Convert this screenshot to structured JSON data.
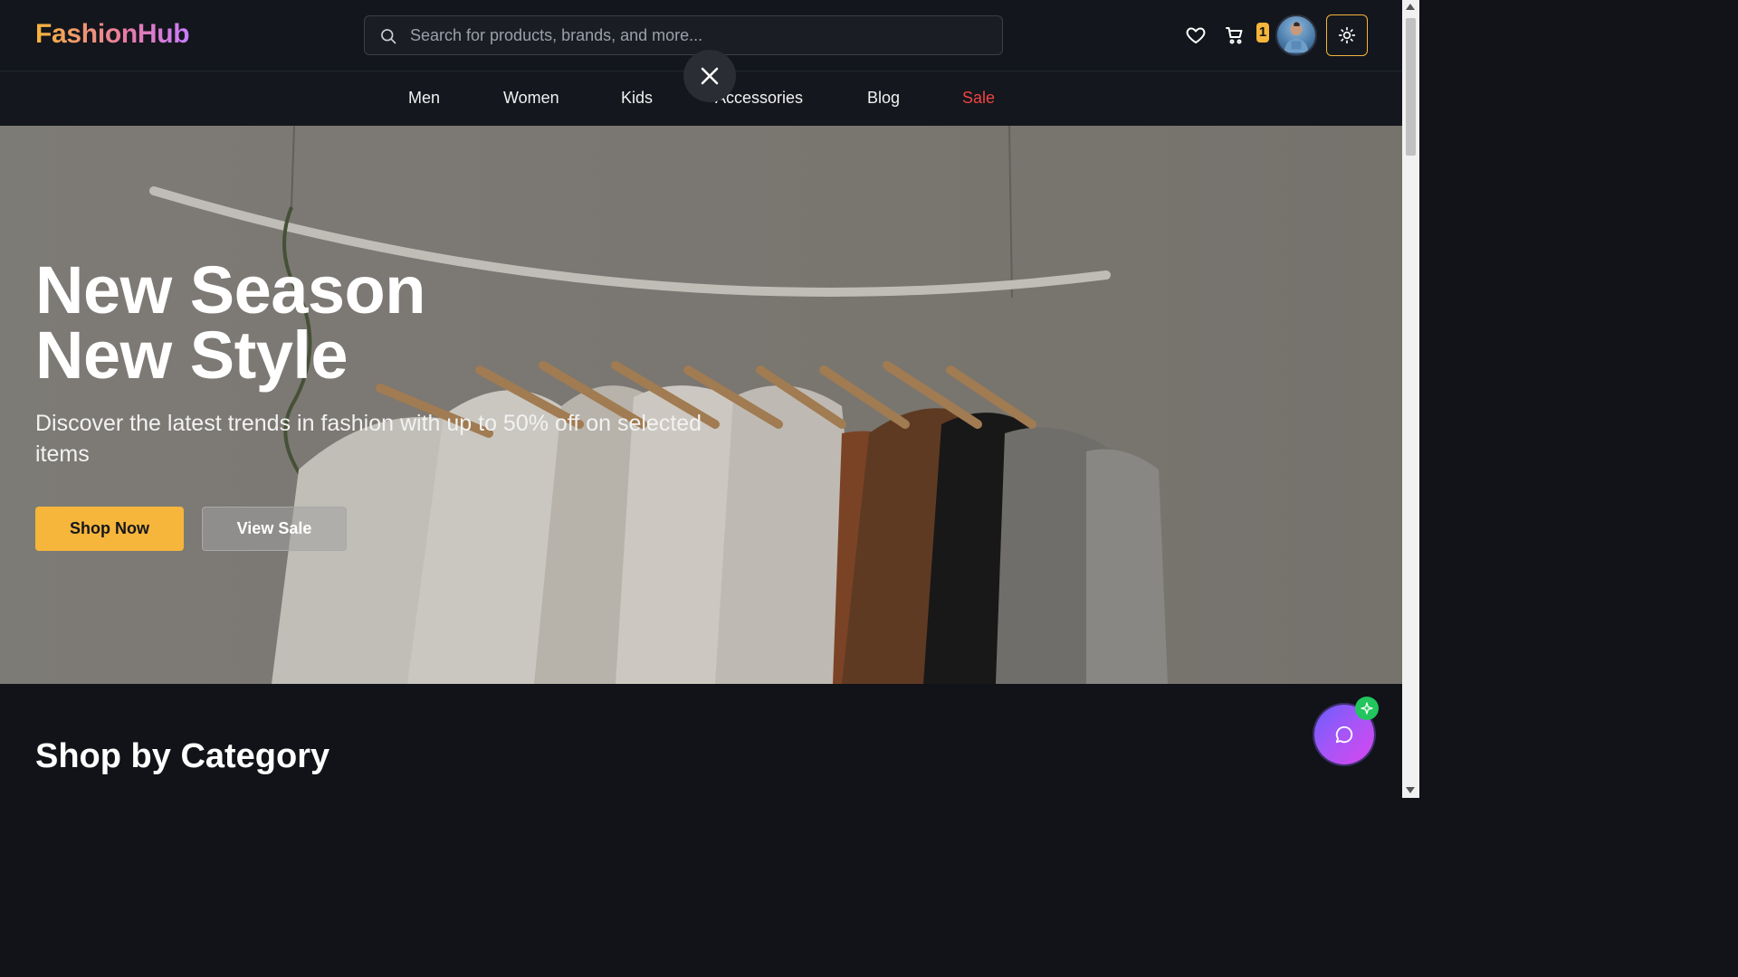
{
  "header": {
    "logo": "FashionHub",
    "search_placeholder": "Search for products, brands, and more...",
    "cart_count": "1",
    "icons": {
      "search": "search-icon",
      "wishlist": "heart-icon",
      "cart": "cart-icon",
      "theme": "sun-icon"
    }
  },
  "nav": {
    "items": [
      {
        "label": "Men"
      },
      {
        "label": "Women"
      },
      {
        "label": "Kids"
      },
      {
        "label": "Accessories"
      },
      {
        "label": "Blog"
      },
      {
        "label": "Sale"
      }
    ]
  },
  "hero": {
    "title_line1": "New Season",
    "title_line2": "New Style",
    "subtitle": "Discover the latest trends in fashion with up to 50% off on selected items",
    "primary_button": "Shop Now",
    "secondary_button": "View Sale"
  },
  "sections": {
    "category_title": "Shop by Category"
  },
  "colors": {
    "accent": "#f6b53b",
    "sale": "#ef4444",
    "background": "#111318"
  }
}
